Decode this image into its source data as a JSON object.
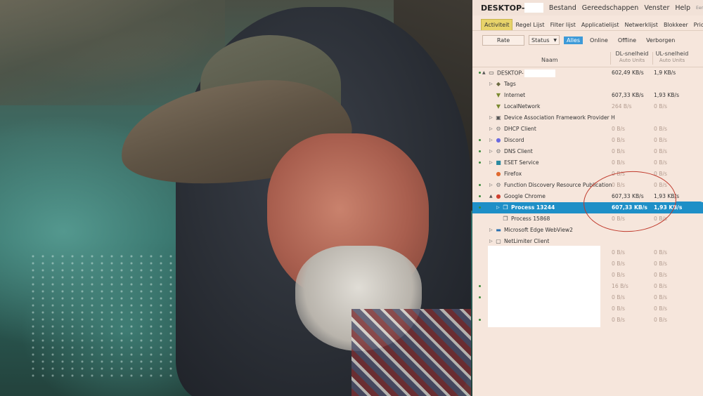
{
  "window": {
    "title": "DESKTOP-",
    "menu": [
      "Bestand",
      "Gereedschappen",
      "Venster",
      "Help",
      "Eer"
    ]
  },
  "tabs": [
    {
      "label": "Activiteit",
      "active": true
    },
    {
      "label": "Regel Lijst",
      "active": false
    },
    {
      "label": "Filter lijst",
      "active": false
    },
    {
      "label": "Applicatielijst",
      "active": false
    },
    {
      "label": "Netwerklijst",
      "active": false
    },
    {
      "label": "Blokkeer",
      "active": false
    },
    {
      "label": "Prioriteit",
      "active": false
    }
  ],
  "toolbar": {
    "rate_label": "Rate",
    "status_value": "Status",
    "filters": [
      {
        "label": "Alles",
        "active": true
      },
      {
        "label": "Online",
        "active": false
      },
      {
        "label": "Offline",
        "active": false
      },
      {
        "label": "Verborgen",
        "active": false
      }
    ]
  },
  "columns": {
    "name": "Naam",
    "dl": "DL-snelheid",
    "dl_unit": "Auto Units",
    "ul": "UL-snelheid",
    "ul_unit": "Auto Units"
  },
  "rows": [
    {
      "name": "DESKTOP-",
      "masked": true,
      "dl": "602,49 KB/s",
      "ul": "1,9 KB/s",
      "icon": "monitor-icon",
      "glyph": "▭",
      "color": "#333",
      "depth": 0,
      "expand": "▲",
      "dot": true
    },
    {
      "name": "Tags",
      "dl": "",
      "ul": "",
      "icon": "tag-icon",
      "glyph": "◆",
      "color": "#6a6a40",
      "depth": 1,
      "expand": "▷"
    },
    {
      "name": "Internet",
      "dl": "607,33 KB/s",
      "ul": "1,93 KB/s",
      "icon": "filter-icon",
      "glyph": "▼",
      "color": "#7a8a30",
      "depth": 1
    },
    {
      "name": "LocalNetwork",
      "dl": "264 B/s",
      "ul": "0 B/s",
      "icon": "filter-icon",
      "glyph": "▼",
      "color": "#7a8a30",
      "depth": 1,
      "dim": true
    },
    {
      "name": "Device Association Framework Provider H",
      "dl": "",
      "ul": "",
      "icon": "service-icon",
      "glyph": "▣",
      "color": "#555",
      "depth": 1,
      "expand": "▷"
    },
    {
      "name": "DHCP Client",
      "dl": "0 B/s",
      "ul": "0 B/s",
      "icon": "gear-icon",
      "glyph": "⚙",
      "color": "#777",
      "depth": 1,
      "expand": "▷",
      "dim": true
    },
    {
      "name": "Discord",
      "dl": "0 B/s",
      "ul": "0 B/s",
      "icon": "discord-icon",
      "glyph": "●",
      "color": "#6a6ae0",
      "depth": 1,
      "expand": "▷",
      "dim": true,
      "dot": true
    },
    {
      "name": "DNS Client",
      "dl": "0 B/s",
      "ul": "0 B/s",
      "icon": "gear-icon",
      "glyph": "⚙",
      "color": "#777",
      "depth": 1,
      "expand": "▷",
      "dim": true,
      "dot": true
    },
    {
      "name": "ESET Service",
      "dl": "0 B/s",
      "ul": "0 B/s",
      "icon": "eset-icon",
      "glyph": "■",
      "color": "#2a8aa0",
      "depth": 1,
      "expand": "▷",
      "dim": true,
      "dot": true
    },
    {
      "name": "Firefox",
      "dl": "0 B/s",
      "ul": "0 B/s",
      "icon": "firefox-icon",
      "glyph": "●",
      "color": "#e06a30",
      "depth": 1,
      "dim": true
    },
    {
      "name": "Function Discovery Resource Publication",
      "dl": "0 B/s",
      "ul": "0 B/s",
      "icon": "gear-icon",
      "glyph": "⚙",
      "color": "#777",
      "depth": 1,
      "expand": "▷",
      "dim": true,
      "dot": true
    },
    {
      "name": "Google Chrome",
      "dl": "607,33 KB/s",
      "ul": "1,93 KB/s",
      "icon": "chrome-icon",
      "glyph": "●",
      "color": "#d04030",
      "depth": 1,
      "expand": "▲",
      "dot": true
    },
    {
      "name": "Process 13244",
      "dl": "607,33 KB/s",
      "ul": "1,93 KB/s",
      "icon": "process-icon",
      "glyph": "❐",
      "color": "#ffffff",
      "depth": 2,
      "expand": "▷",
      "selected": true,
      "dot": true
    },
    {
      "name": "Process 15868",
      "dl": "0 B/s",
      "ul": "0 B/s",
      "icon": "process-icon",
      "glyph": "❐",
      "color": "#555",
      "depth": 2,
      "dim": true
    },
    {
      "name": "Microsoft Edge WebView2",
      "dl": "",
      "ul": "",
      "icon": "edge-icon",
      "glyph": "▬",
      "color": "#2a70b0",
      "depth": 1,
      "expand": "▷"
    },
    {
      "name": "NetLimiter Client",
      "dl": "",
      "ul": "",
      "icon": "netlimiter-icon",
      "glyph": "▢",
      "color": "#555",
      "depth": 1,
      "expand": "▷"
    },
    {
      "name": "",
      "dl": "0 B/s",
      "ul": "0 B/s",
      "blank": true
    },
    {
      "name": "",
      "dl": "0 B/s",
      "ul": "0 B/s",
      "blank": true
    },
    {
      "name": "",
      "dl": "0 B/s",
      "ul": "0 B/s",
      "blank": true
    },
    {
      "name": "",
      "dl": "16 B/s",
      "ul": "0 B/s",
      "blank": true,
      "dot": true
    },
    {
      "name": "",
      "dl": "0 B/s",
      "ul": "0 B/s",
      "blank": true,
      "dot": true
    },
    {
      "name": "",
      "dl": "0 B/s",
      "ul": "0 B/s",
      "blank": true
    },
    {
      "name": "",
      "dl": "0 B/s",
      "ul": "0 B/s",
      "blank": true,
      "dot": true
    }
  ]
}
